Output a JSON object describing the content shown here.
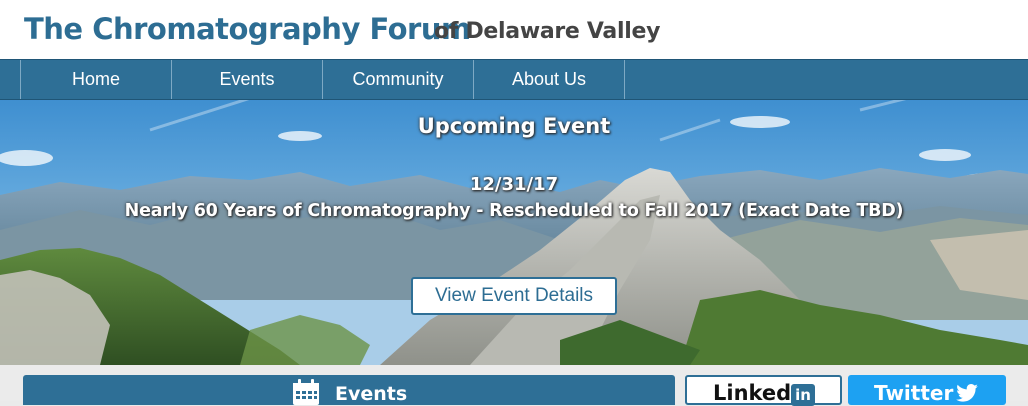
{
  "header": {
    "site_name": "The Chromatography Forum",
    "site_region": "of Delaware Valley"
  },
  "nav": {
    "items": [
      {
        "label": "Home"
      },
      {
        "label": "Events"
      },
      {
        "label": "Community"
      },
      {
        "label": "About Us"
      }
    ]
  },
  "hero": {
    "heading": "Upcoming Event",
    "date": "12/31/17",
    "event_title": "Nearly 60 Years of Chromatography - Rescheduled to Fall 2017 (Exact Date TBD)",
    "button_label": "View Event Details"
  },
  "panels": {
    "events_label": "Events",
    "linkedin_label": "Linked",
    "linkedin_badge": "in",
    "twitter_label": "Twitter"
  },
  "icons": {
    "events_icon": "calendar-icon",
    "twitter_icon": "twitter-bird-icon"
  },
  "colors": {
    "brand_blue": "#2e6f96",
    "twitter_blue": "#1da1f2"
  }
}
